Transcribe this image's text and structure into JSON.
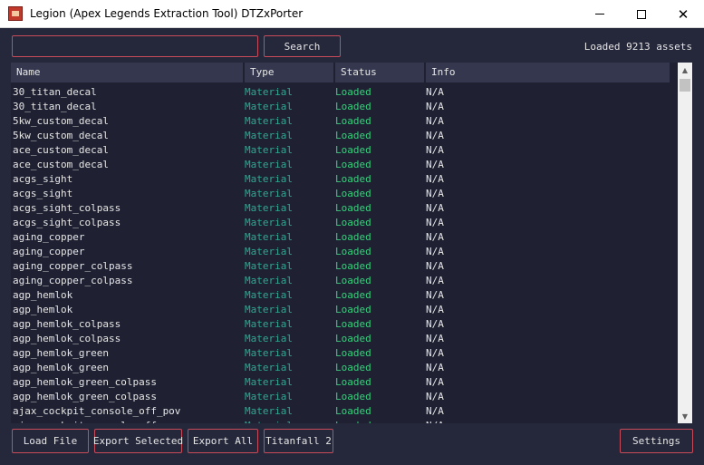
{
  "window": {
    "title": "Legion (Apex Legends Extraction Tool) DTZxPorter",
    "minimize_icon": "minimize-icon",
    "maximize_icon": "maximize-icon",
    "close_glyph": "✕"
  },
  "toolbar": {
    "search_value": "",
    "search_label": "Search",
    "asset_count": "Loaded 9213 assets"
  },
  "table": {
    "columns": [
      "Name",
      "Type",
      "Status",
      "Info"
    ],
    "rows": [
      {
        "name": "30_titan_decal",
        "type": "Material",
        "status": "Loaded",
        "info": "N/A"
      },
      {
        "name": "30_titan_decal",
        "type": "Material",
        "status": "Loaded",
        "info": "N/A"
      },
      {
        "name": "5kw_custom_decal",
        "type": "Material",
        "status": "Loaded",
        "info": "N/A"
      },
      {
        "name": "5kw_custom_decal",
        "type": "Material",
        "status": "Loaded",
        "info": "N/A"
      },
      {
        "name": "ace_custom_decal",
        "type": "Material",
        "status": "Loaded",
        "info": "N/A"
      },
      {
        "name": "ace_custom_decal",
        "type": "Material",
        "status": "Loaded",
        "info": "N/A"
      },
      {
        "name": "acgs_sight",
        "type": "Material",
        "status": "Loaded",
        "info": "N/A"
      },
      {
        "name": "acgs_sight",
        "type": "Material",
        "status": "Loaded",
        "info": "N/A"
      },
      {
        "name": "acgs_sight_colpass",
        "type": "Material",
        "status": "Loaded",
        "info": "N/A"
      },
      {
        "name": "acgs_sight_colpass",
        "type": "Material",
        "status": "Loaded",
        "info": "N/A"
      },
      {
        "name": "aging_copper",
        "type": "Material",
        "status": "Loaded",
        "info": "N/A"
      },
      {
        "name": "aging_copper",
        "type": "Material",
        "status": "Loaded",
        "info": "N/A"
      },
      {
        "name": "aging_copper_colpass",
        "type": "Material",
        "status": "Loaded",
        "info": "N/A"
      },
      {
        "name": "aging_copper_colpass",
        "type": "Material",
        "status": "Loaded",
        "info": "N/A"
      },
      {
        "name": "agp_hemlok",
        "type": "Material",
        "status": "Loaded",
        "info": "N/A"
      },
      {
        "name": "agp_hemlok",
        "type": "Material",
        "status": "Loaded",
        "info": "N/A"
      },
      {
        "name": "agp_hemlok_colpass",
        "type": "Material",
        "status": "Loaded",
        "info": "N/A"
      },
      {
        "name": "agp_hemlok_colpass",
        "type": "Material",
        "status": "Loaded",
        "info": "N/A"
      },
      {
        "name": "agp_hemlok_green",
        "type": "Material",
        "status": "Loaded",
        "info": "N/A"
      },
      {
        "name": "agp_hemlok_green",
        "type": "Material",
        "status": "Loaded",
        "info": "N/A"
      },
      {
        "name": "agp_hemlok_green_colpass",
        "type": "Material",
        "status": "Loaded",
        "info": "N/A"
      },
      {
        "name": "agp_hemlok_green_colpass",
        "type": "Material",
        "status": "Loaded",
        "info": "N/A"
      },
      {
        "name": "ajax_cockpit_console_off_pov",
        "type": "Material",
        "status": "Loaded",
        "info": "N/A"
      },
      {
        "name": "ajax_cockpit_console_off",
        "type": "Material",
        "status": "Loaded",
        "info": "N/A"
      }
    ]
  },
  "footer": {
    "load_file": "Load File",
    "export_selected": "Export Selected",
    "export_all": "Export All",
    "game": "Titanfall 2",
    "settings": "Settings"
  },
  "colors": {
    "background": "#25273b",
    "accent_border": "#c94b5a",
    "type_text": "#2fa88f",
    "status_text": "#33d17a",
    "header_bg": "#34374e"
  }
}
